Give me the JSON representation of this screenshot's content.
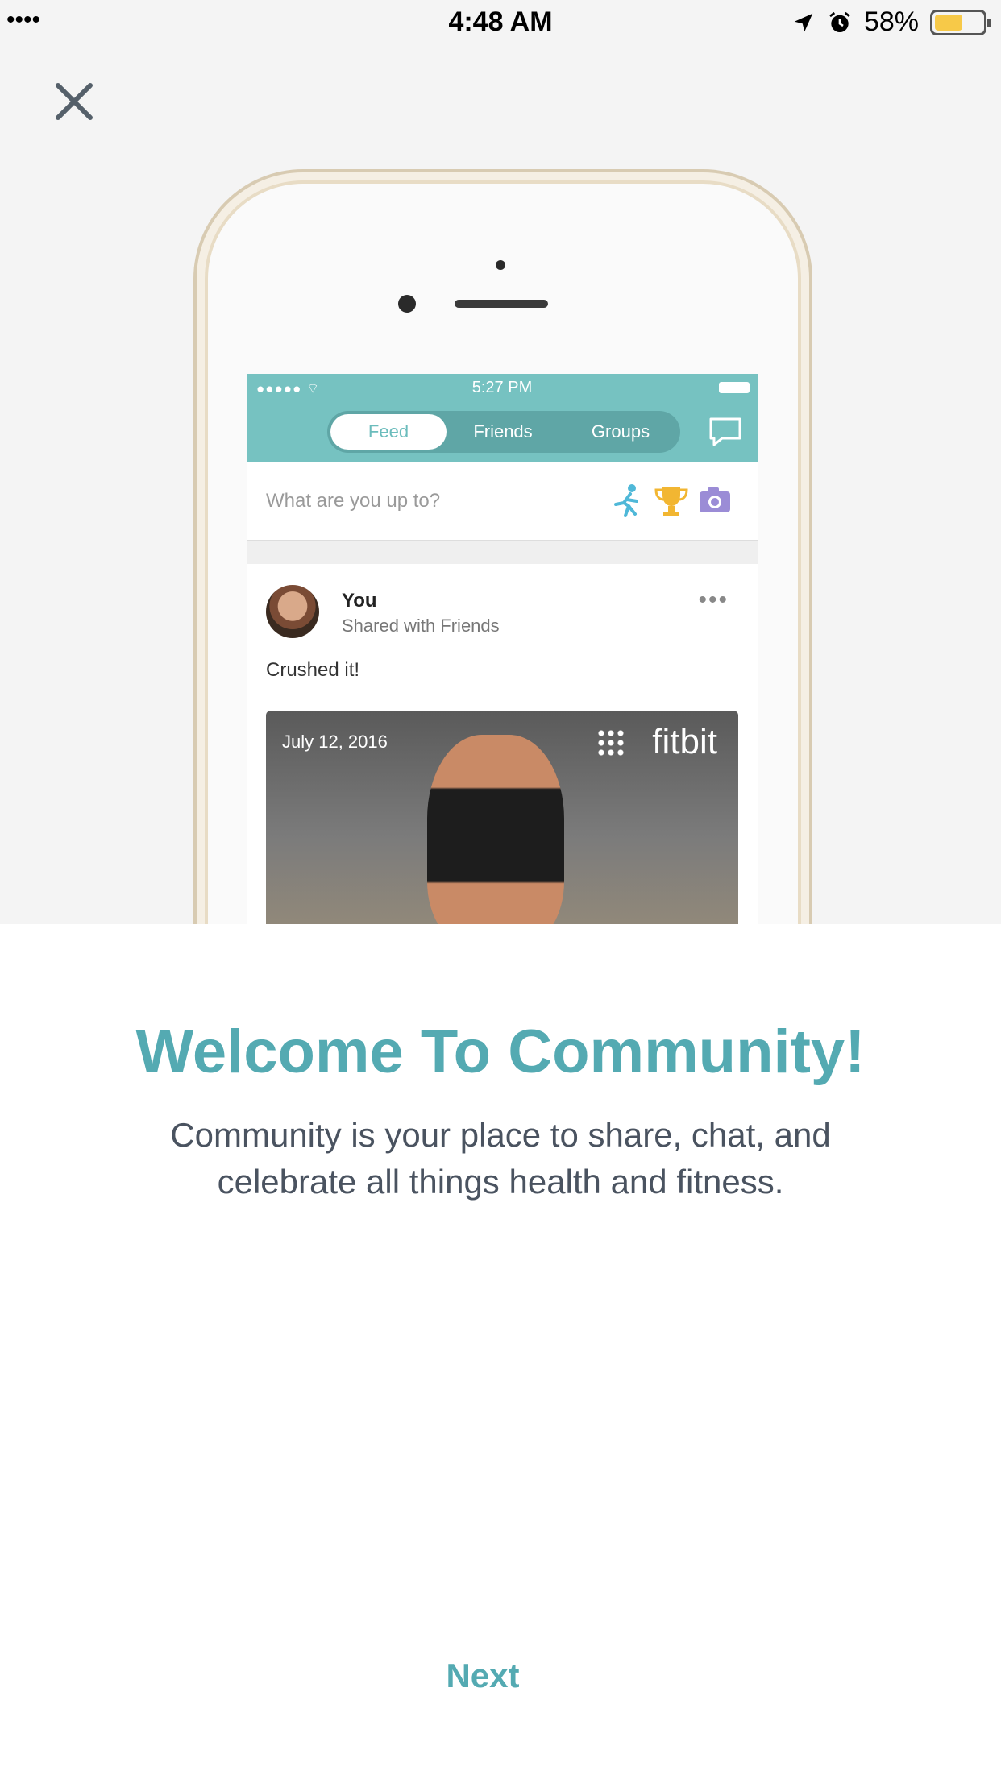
{
  "status_bar": {
    "carrier": "••••",
    "time": "4:48 AM",
    "battery_percent": "58%",
    "battery_level": 0.58,
    "battery_color": "#f7c948",
    "icons": [
      "location-icon",
      "alarm-icon",
      "battery-icon"
    ]
  },
  "header": {
    "close_icon": "close-icon"
  },
  "illustration": {
    "status_time": "5:27 PM",
    "signal": "●●●●● ⌔",
    "tabs": [
      "Feed",
      "Friends",
      "Groups"
    ],
    "active_tab": "Feed",
    "compose_placeholder": "What are you up to?",
    "post": {
      "author": "You",
      "visibility": "Shared with Friends",
      "more": "•••",
      "message": "Crushed it!",
      "photo_date": "July 12, 2016",
      "photo_brand": "fitbit"
    },
    "accent_color": "#76c2c1"
  },
  "content": {
    "title": "Welcome To Community!",
    "description": "Community is your place to share, chat, and celebrate all things health and fitness."
  },
  "footer": {
    "next_label": "Next"
  },
  "colors": {
    "brand": "#54aab2",
    "body_text": "#4a5360",
    "hero_bg": "#f4f4f4"
  }
}
